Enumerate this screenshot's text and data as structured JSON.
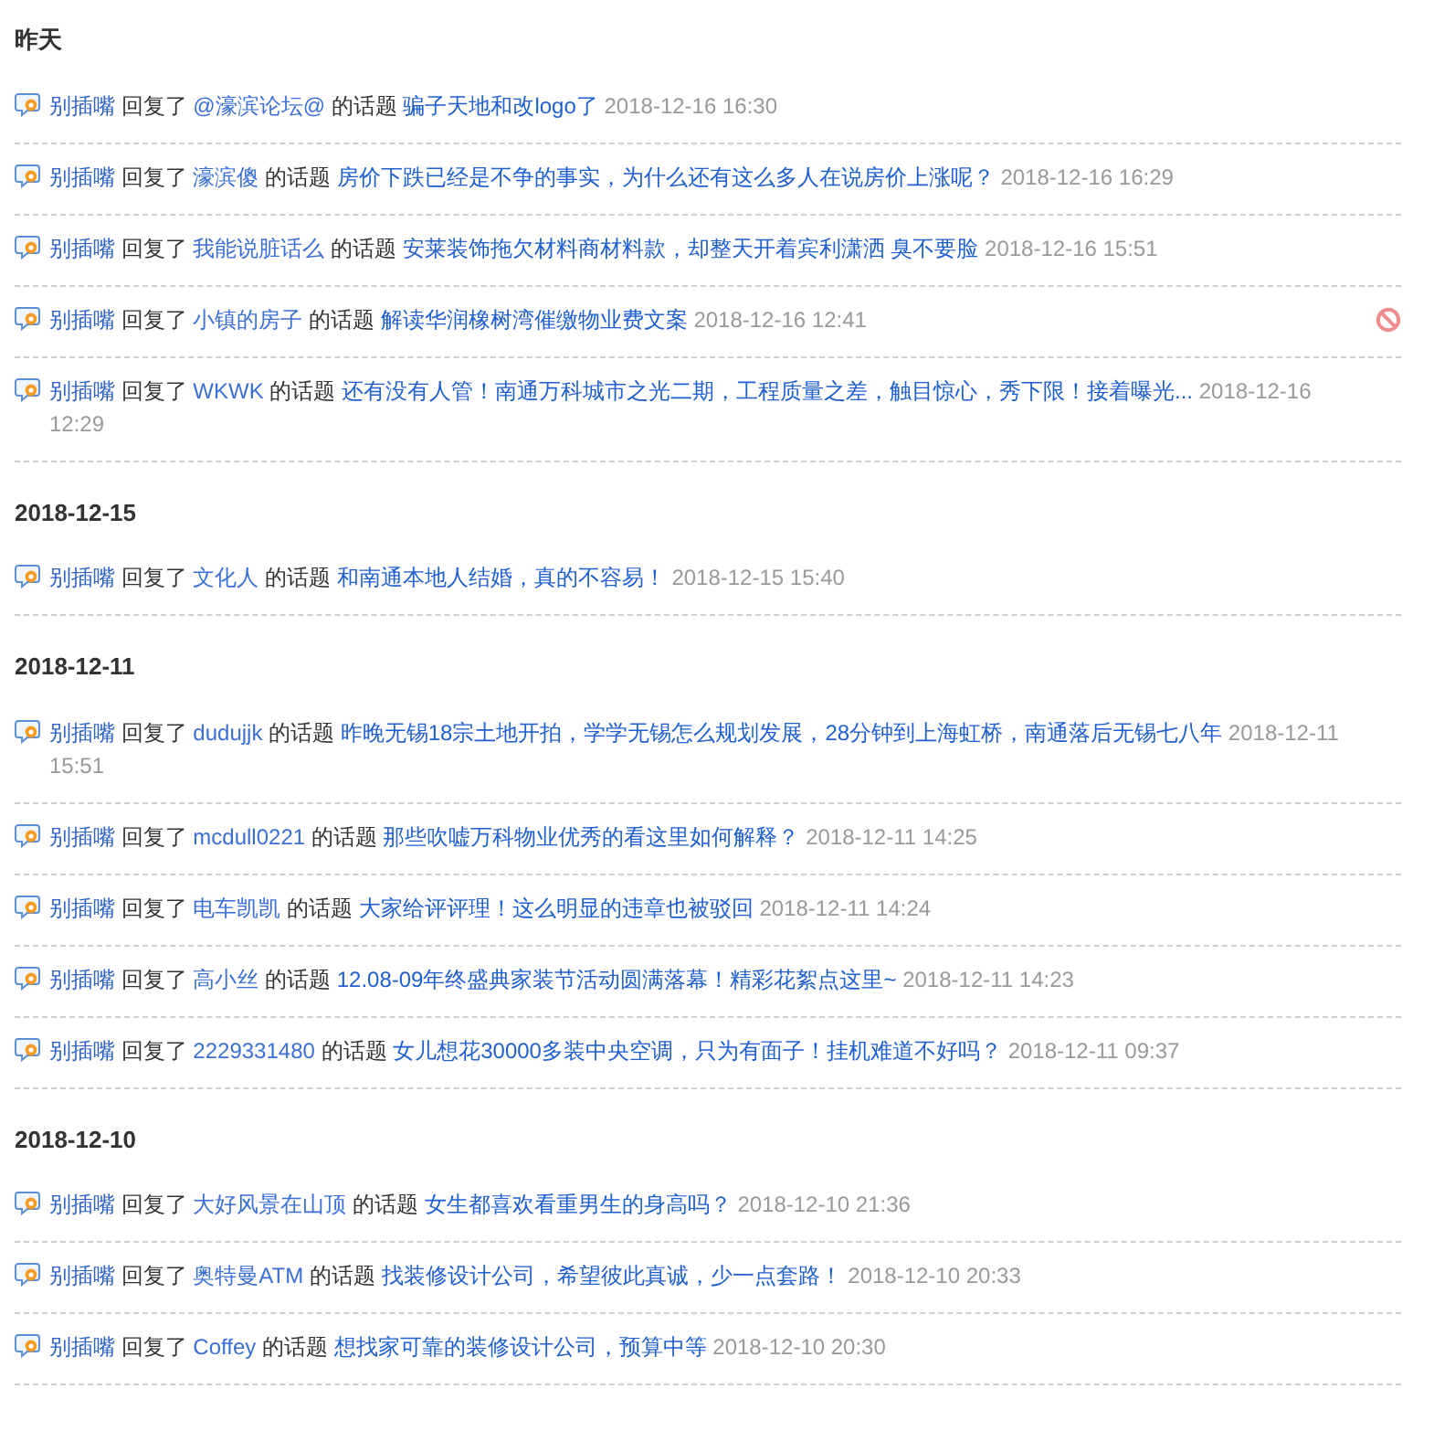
{
  "groups": [
    {
      "heading": "昨天",
      "entries": [
        {
          "user": "别插嘴",
          "action": "回复了",
          "author": "@濠滨论坛@",
          "relation": "的话题",
          "topic": "骗子天地和改logo了",
          "time": "2018-12-16 16:30",
          "deletable": false
        },
        {
          "user": "别插嘴",
          "action": "回复了",
          "author": "濠滨傻",
          "relation": "的话题",
          "topic": "房价下跌已经是不争的事实，为什么还有这么多人在说房价上涨呢？",
          "time": "2018-12-16 16:29",
          "deletable": false
        },
        {
          "user": "别插嘴",
          "action": "回复了",
          "author": "我能说脏话么",
          "relation": "的话题",
          "topic": "安莱装饰拖欠材料商材料款，却整天开着宾利潇洒 臭不要脸",
          "time": "2018-12-16 15:51",
          "deletable": false
        },
        {
          "user": "别插嘴",
          "action": "回复了",
          "author": "小镇的房子",
          "relation": "的话题",
          "topic": "解读华润橡树湾催缴物业费文案",
          "time": "2018-12-16 12:41",
          "deletable": true
        },
        {
          "user": "别插嘴",
          "action": "回复了",
          "author": "WKWK",
          "relation": "的话题",
          "topic": "还有没有人管！南通万科城市之光二期，工程质量之差，触目惊心，秀下限！接着曝光...",
          "time": "2018-12-16 12:29",
          "deletable": false
        }
      ]
    },
    {
      "heading": "2018-12-15",
      "entries": [
        {
          "user": "别插嘴",
          "action": "回复了",
          "author": "文化人",
          "relation": "的话题",
          "topic": "和南通本地人结婚，真的不容易！",
          "time": "2018-12-15 15:40",
          "deletable": false
        }
      ]
    },
    {
      "heading": "2018-12-11",
      "entries": [
        {
          "user": "别插嘴",
          "action": "回复了",
          "author": "dudujjk",
          "relation": "的话题",
          "topic": "昨晚无锡18宗土地开拍，学学无锡怎么规划发展，28分钟到上海虹桥，南通落后无锡七八年",
          "time": "2018-12-11 15:51",
          "deletable": false
        },
        {
          "user": "别插嘴",
          "action": "回复了",
          "author": "mcdull0221",
          "relation": "的话题",
          "topic": "那些吹嘘万科物业优秀的看这里如何解释？",
          "time": "2018-12-11 14:25",
          "deletable": false
        },
        {
          "user": "别插嘴",
          "action": "回复了",
          "author": "电车凯凯",
          "relation": "的话题",
          "topic": "大家给评评理！这么明显的违章也被驳回",
          "time": "2018-12-11 14:24",
          "deletable": false
        },
        {
          "user": "别插嘴",
          "action": "回复了",
          "author": "高小丝",
          "relation": "的话题",
          "topic": "12.08-09年终盛典家装节活动圆满落幕！精彩花絮点这里~",
          "time": "2018-12-11 14:23",
          "deletable": false
        },
        {
          "user": "别插嘴",
          "action": "回复了",
          "author": "2229331480",
          "relation": "的话题",
          "topic": "女儿想花30000多装中央空调，只为有面子！挂机难道不好吗？",
          "time": "2018-12-11 09:37",
          "deletable": false
        }
      ]
    },
    {
      "heading": "2018-12-10",
      "entries": [
        {
          "user": "别插嘴",
          "action": "回复了",
          "author": "大好风景在山顶",
          "relation": "的话题",
          "topic": "女生都喜欢看重男生的身高吗？",
          "time": "2018-12-10 21:36",
          "deletable": false
        },
        {
          "user": "别插嘴",
          "action": "回复了",
          "author": "奥特曼ATM",
          "relation": "的话题",
          "topic": "找装修设计公司，希望彼此真诚，少一点套路！",
          "time": "2018-12-10 20:33",
          "deletable": false
        },
        {
          "user": "别插嘴",
          "action": "回复了",
          "author": "Coffey",
          "relation": "的话题",
          "topic": "想找家可靠的装修设计公司，预算中等",
          "time": "2018-12-10 20:30",
          "deletable": false
        }
      ]
    }
  ]
}
